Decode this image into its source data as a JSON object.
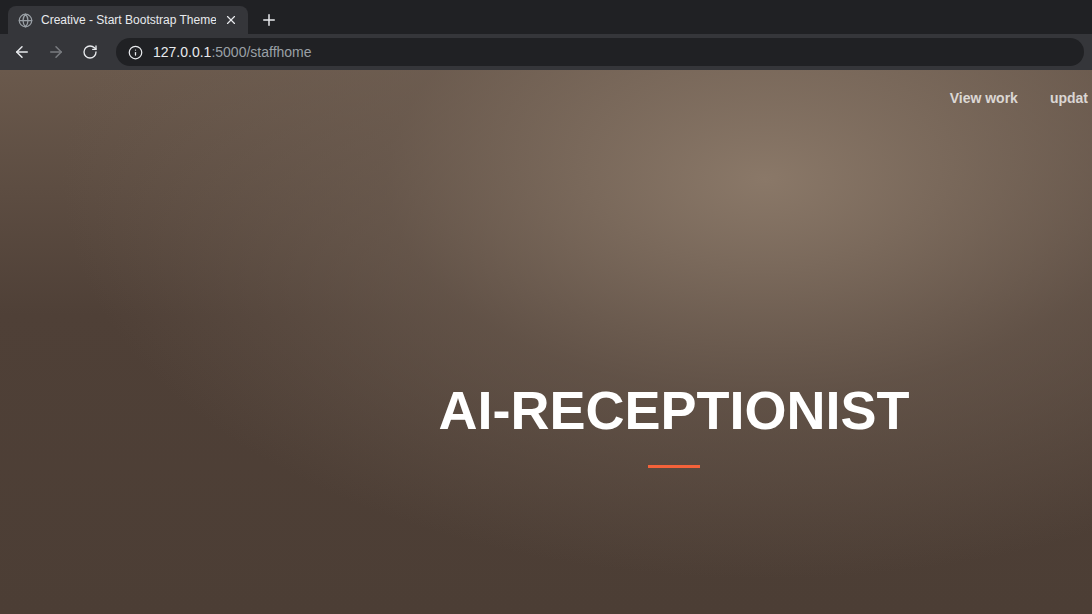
{
  "window": {
    "tabs": [
      {
        "title": "Creative - Start Bootstrap Theme",
        "selected": true
      }
    ]
  },
  "toolbar": {
    "back_disabled": false,
    "forward_disabled": true
  },
  "address_bar": {
    "host": "127.0.0.1",
    "path": ":5000/staffhome"
  },
  "nav": {
    "links": [
      "View work",
      "updat"
    ]
  },
  "hero": {
    "title": "AI-RECEPTIONIST"
  }
}
